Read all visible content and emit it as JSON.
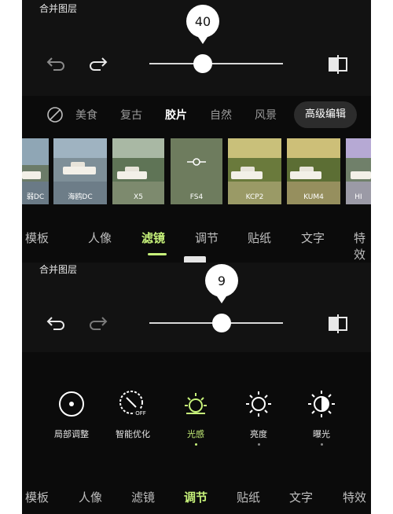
{
  "panel1": {
    "merge_label": "合并图层",
    "slider_value": "40",
    "filter_categories": [
      "美食",
      "复古",
      "胶片",
      "自然",
      "风景"
    ],
    "advanced_button": "高级编辑",
    "thumbnails": [
      "弱DC",
      "海鸥DC",
      "X5",
      "FS4",
      "KCP2",
      "KUM4",
      "HI"
    ],
    "tabs": [
      "模板",
      "人像",
      "滤镜",
      "调节",
      "贴纸",
      "文字",
      "特效"
    ]
  },
  "panel2": {
    "merge_label": "合并图层",
    "slider_value": "9",
    "tools": [
      "局部调整",
      "智能优化",
      "光感",
      "亮度",
      "曝光"
    ],
    "tabs": [
      "模板",
      "人像",
      "滤镜",
      "调节",
      "贴纸",
      "文字",
      "特效"
    ]
  },
  "colors": {
    "accent": "#c7f27a",
    "background": "#0b0b0b"
  },
  "icons": [
    "undo-icon",
    "redo-icon",
    "compare-icon",
    "no-filter-icon",
    "target-icon",
    "magic-wand-icon",
    "sun-icon",
    "brightness-icon",
    "exposure-icon"
  ]
}
